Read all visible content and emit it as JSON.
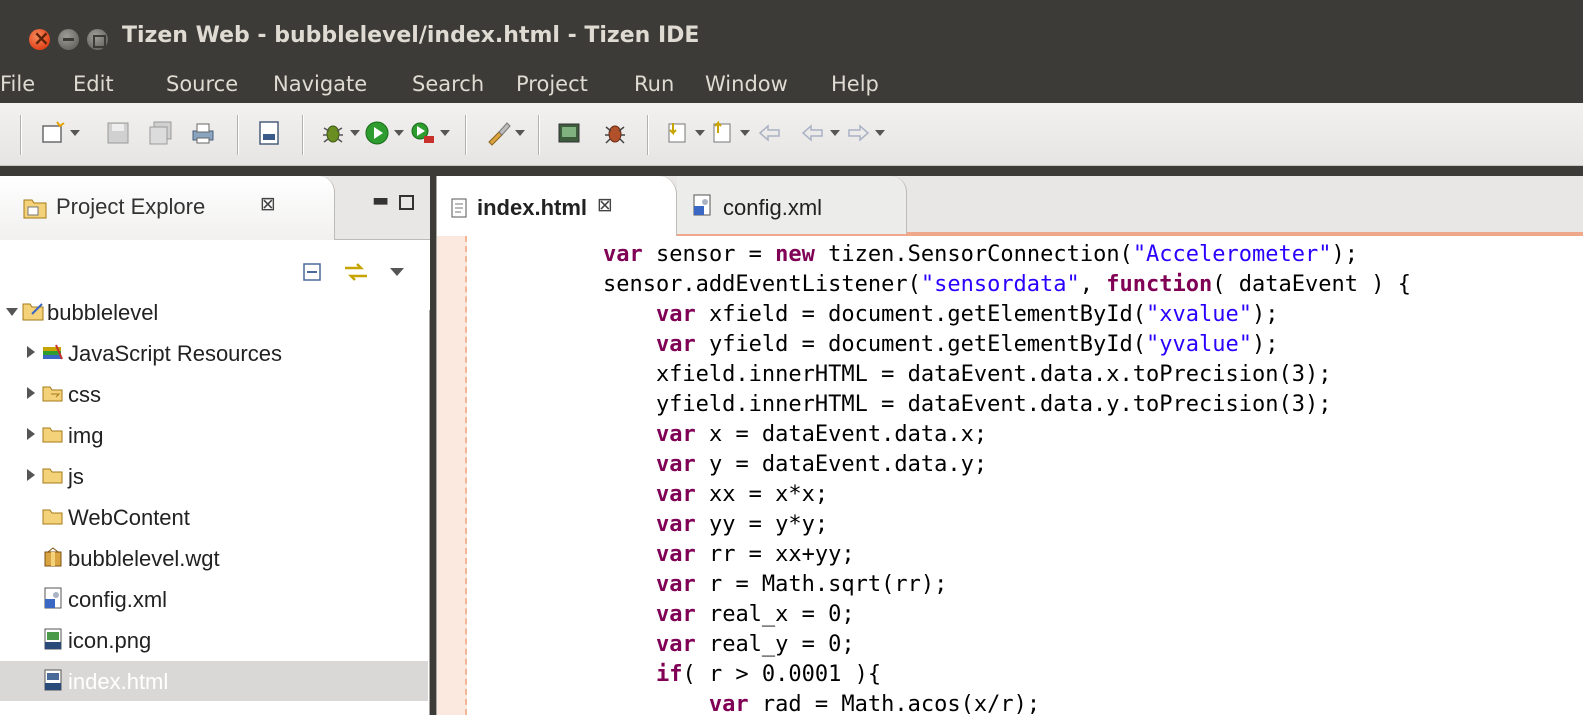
{
  "window": {
    "title": "Tizen Web - bubblelevel/index.html - Tizen IDE"
  },
  "menu": [
    "File",
    "Edit",
    "Source",
    "Navigate",
    "Search",
    "Project",
    "Run",
    "Window",
    "Help"
  ],
  "explorer": {
    "tab_label": "Project Explore",
    "close_glyph": "⊠",
    "tree": [
      {
        "label": "bubblelevel",
        "level": 0,
        "expand": "expanded",
        "icon": "project-folder-icon"
      },
      {
        "label": "JavaScript Resources",
        "level": 1,
        "expand": "collapsed",
        "icon": "library-icon"
      },
      {
        "label": "css",
        "level": 1,
        "expand": "collapsed",
        "icon": "folder-icon"
      },
      {
        "label": "img",
        "level": 1,
        "expand": "collapsed",
        "icon": "folder-icon"
      },
      {
        "label": "js",
        "level": 1,
        "expand": "collapsed",
        "icon": "folder-icon"
      },
      {
        "label": "WebContent",
        "level": 1,
        "expand": "none",
        "icon": "folder-icon"
      },
      {
        "label": "bubblelevel.wgt",
        "level": 1,
        "expand": "none",
        "icon": "package-icon"
      },
      {
        "label": "config.xml",
        "level": 1,
        "expand": "none",
        "icon": "xml-file-icon"
      },
      {
        "label": "icon.png",
        "level": 1,
        "expand": "none",
        "icon": "png-file-icon"
      },
      {
        "label": "index.html",
        "level": 1,
        "expand": "none",
        "icon": "html-file-icon",
        "selected": true
      }
    ]
  },
  "editor": {
    "tabs": [
      {
        "label": "index.html",
        "close_glyph": "⊠",
        "active": true
      },
      {
        "label": "config.xml",
        "active": false
      }
    ],
    "code_lines": [
      "        var sensor = new tizen.SensorConnection(\"Accelerometer\");",
      "        sensor.addEventListener(\"sensordata\", function( dataEvent ) {",
      "            var xfield = document.getElementById(\"xvalue\");",
      "            var yfield = document.getElementById(\"yvalue\");",
      "            xfield.innerHTML = dataEvent.data.x.toPrecision(3);",
      "            yfield.innerHTML = dataEvent.data.y.toPrecision(3);",
      "            var x = dataEvent.data.x;",
      "            var y = dataEvent.data.y;",
      "            var xx = x*x;",
      "            var yy = y*y;",
      "            var rr = xx+yy;",
      "            var r = Math.sqrt(rr);",
      "            var real_x = 0;",
      "            var real_y = 0;",
      "            if( r > 0.0001 ){",
      "                var rad = Math.acos(x/r);"
    ]
  },
  "colors": {
    "keyword": "#7f0055",
    "string": "#2a00ff",
    "gutter": "#fbe8df",
    "titlebar": "#3c3b37"
  }
}
